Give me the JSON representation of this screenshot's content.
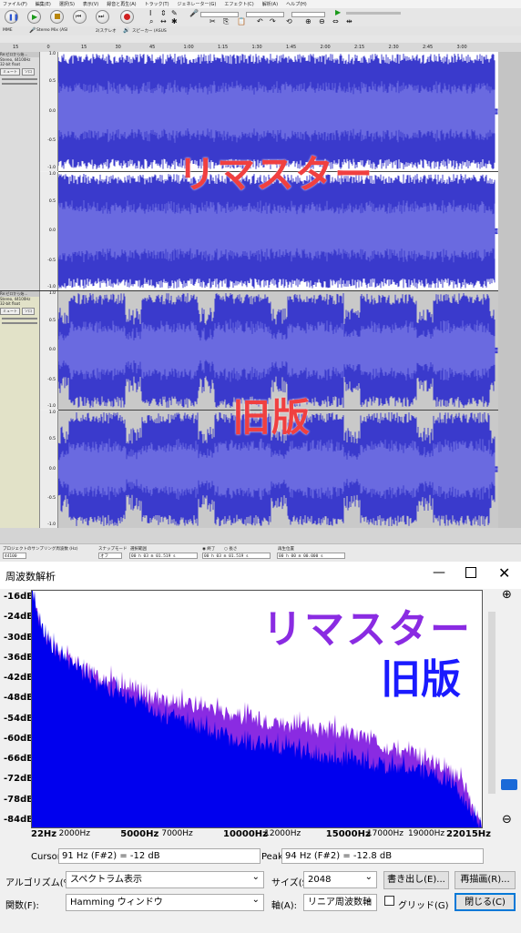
{
  "menu": [
    "ファイル(F)",
    "編集(E)",
    "選択(S)",
    "表示(V)",
    "録音と再生(A)",
    "トラック(T)",
    "ジェネレーター(G)",
    "エフェクト(C)",
    "解析(A)",
    "ヘルプ(H)"
  ],
  "device": {
    "host": "MME",
    "input": "Stereo Mix (ASI",
    "channels": "2(ステレオ",
    "output": "スピーカー (ASUS"
  },
  "ruler_ticks": [
    "15",
    "0",
    "15",
    "30",
    "45",
    "1:00",
    "1:15",
    "1:30",
    "1:45",
    "2:00",
    "2:15",
    "2:30",
    "2:45",
    "3:00"
  ],
  "tracks": [
    {
      "name": "Re:ゼロから始…",
      "info": "Stereo, 44100Hz",
      "format": "32-bit float",
      "mute": "ミュート",
      "solo": "ソロ"
    },
    {
      "name": "Re:ゼロから始…",
      "info": "Stereo, 44100Hz",
      "format": "32-bit float",
      "mute": "ミュート",
      "solo": "ソロ"
    }
  ],
  "scale_labels": [
    "1.0",
    "0.5",
    "0.0",
    "-0.5",
    "-1.0"
  ],
  "overlay_top": {
    "remaster": "リマスター",
    "old": "旧版"
  },
  "status": {
    "rate_label": "プロジェクトのサンプリング周波数 (Hz)",
    "rate_value": "44100",
    "snap_label": "スナップモード",
    "snap_value": "オフ",
    "selection_label": "選択範囲",
    "end_label": "終了",
    "length_label": "長さ",
    "sel_start": "00 h 03 m 01.519 s",
    "sel_end": "00 h 03 m 01.519 s",
    "pos_label": "再生位置",
    "pos_value": "00 h 00 m 00.000 s"
  },
  "fa": {
    "title": "周波数解析",
    "y_labels": [
      "-16dB",
      "-24dB",
      "-30dB",
      "-36dB",
      "-42dB",
      "-48dB",
      "-54dB",
      "-60dB",
      "-66dB",
      "-72dB",
      "-78dB",
      "-84dB"
    ],
    "x_labels": [
      "22Hz",
      "2000Hz",
      "5000Hz",
      "7000Hz",
      "10000Hz",
      "12000Hz",
      "15000Hz",
      "17000Hz",
      "19000Hz",
      "22015Hz"
    ],
    "legend_remaster": "リマスター",
    "legend_old": "旧版",
    "cursor_label": "Cursor:",
    "cursor_value": "91 Hz (F#2) = -12 dB",
    "peak_label": "Peak:",
    "peak_value": "94 Hz (F#2) = -12.8 dB",
    "algorithm_label": "アルゴリズム(%A):",
    "algorithm_value": "スペクトラム表示",
    "size_label": "サイズ(S):",
    "size_value": "2048",
    "export_button": "書き出し(E)...",
    "replot_button": "再描画(R)...",
    "function_label": "関数(F):",
    "function_value": "Hamming ウィンドウ",
    "axis_label": "軸(A):",
    "axis_value": "リニア周波数軸",
    "grid_label": "グリッド(G)",
    "close_button": "閉じる(C)"
  },
  "colors": {
    "wave": "#3a3acc",
    "wave_light": "#6a6ae0",
    "overlay_red": "#f04040",
    "spectrum_remaster": "#8a2be2",
    "spectrum_old": "#0000ee"
  },
  "chart_data": {
    "type": "area",
    "title": "周波数解析",
    "xlabel": "",
    "ylabel": "",
    "xlim": [
      22,
      22015
    ],
    "ylim": [
      -84,
      -16
    ],
    "series": [
      {
        "name": "リマスター",
        "x": [
          22,
          500,
          1000,
          2000,
          3000,
          4000,
          5000,
          6000,
          7000,
          8000,
          9000,
          10000,
          11000,
          12000,
          13000,
          14000,
          15000,
          16000,
          17000,
          18000,
          19000,
          20000,
          21000,
          21500,
          22015
        ],
        "values": [
          -16,
          -27,
          -32,
          -37,
          -40,
          -42,
          -45,
          -47,
          -48,
          -49,
          -50,
          -52,
          -53,
          -54,
          -55,
          -56,
          -57,
          -58,
          -60,
          -62,
          -64,
          -66,
          -70,
          -78,
          -84
        ]
      },
      {
        "name": "旧版",
        "x": [
          22,
          500,
          1000,
          2000,
          3000,
          4000,
          5000,
          6000,
          7000,
          8000,
          9000,
          10000,
          11000,
          12000,
          13000,
          14000,
          15000,
          16000,
          17000,
          18000,
          19000,
          20000,
          21000,
          21500,
          22015
        ],
        "values": [
          -16,
          -27,
          -32,
          -38,
          -42,
          -45,
          -48,
          -51,
          -53,
          -55,
          -57,
          -59,
          -60,
          -61,
          -62,
          -63,
          -64,
          -65,
          -66,
          -67,
          -68,
          -70,
          -74,
          -80,
          -84
        ]
      }
    ]
  }
}
